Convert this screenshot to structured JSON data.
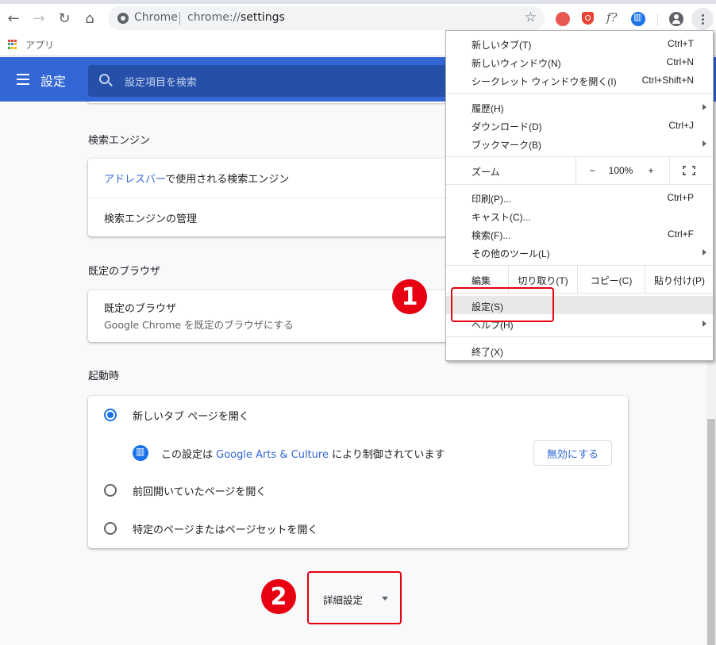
{
  "browser": {
    "omnibox": {
      "site_chip": "Chrome",
      "url_scheme": "chrome://",
      "url_path": "settings"
    },
    "bookmarks": {
      "apps_label": "アプリ"
    },
    "extensions": [
      "red-extension-icon",
      "shield-extension-icon",
      "font-detect-extension-icon",
      "arts-culture-extension-icon"
    ]
  },
  "settings_header": {
    "title": "設定",
    "search_placeholder": "設定項目を検索"
  },
  "sections": {
    "search_engine": {
      "title": "検索エンジン",
      "row1_link": "アドレスバー",
      "row1_rest": "で使用される検索エンジン",
      "row2": "検索エンジンの管理"
    },
    "default_browser": {
      "title": "既定のブラウザ",
      "row_title": "既定のブラウザ",
      "row_sub": "Google Chrome を既定のブラウザにする"
    },
    "on_startup": {
      "title": "起動時",
      "options": [
        {
          "label": "新しいタブ ページを開く",
          "checked": true
        },
        {
          "label": "前回開いていたページを開く",
          "checked": false
        },
        {
          "label": "特定のページまたはページセットを開く",
          "checked": false
        }
      ],
      "policy_prefix": "この設定は ",
      "policy_ext": "Google Arts & Culture",
      "policy_suffix": " により制御されています",
      "disable_button": "無効にする"
    },
    "advanced": {
      "label": "詳細設定"
    }
  },
  "annotations": {
    "badge1": "1",
    "badge2": "2",
    "color": "#e60012"
  },
  "chrome_menu": {
    "new_tab": {
      "label": "新しいタブ(T)",
      "shortcut": "Ctrl+T"
    },
    "new_window": {
      "label": "新しいウィンドウ(N)",
      "shortcut": "Ctrl+N"
    },
    "incognito": {
      "label": "シークレット ウィンドウを開く(I)",
      "shortcut": "Ctrl+Shift+N"
    },
    "history": {
      "label": "履歴(H)"
    },
    "downloads": {
      "label": "ダウンロード(D)",
      "shortcut": "Ctrl+J"
    },
    "bookmarks": {
      "label": "ブックマーク(B)"
    },
    "zoom": {
      "label": "ズーム",
      "minus": "−",
      "value": "100%",
      "plus": "+"
    },
    "print": {
      "label": "印刷(P)...",
      "shortcut": "Ctrl+P"
    },
    "cast": {
      "label": "キャスト(C)..."
    },
    "find": {
      "label": "検索(F)...",
      "shortcut": "Ctrl+F"
    },
    "more_tools": {
      "label": "その他のツール(L)"
    },
    "edit": {
      "label": "編集",
      "cut": "切り取り(T)",
      "copy": "コピー(C)",
      "paste": "貼り付け(P)"
    },
    "settings": {
      "label": "設定(S)"
    },
    "help": {
      "label": "ヘルプ(H)"
    },
    "exit": {
      "label": "終了(X)"
    }
  },
  "colors": {
    "header_blue": "#3367d6",
    "search_blue": "#254fa8",
    "link_blue": "#3367d6",
    "radio_blue": "#1a73e8"
  }
}
